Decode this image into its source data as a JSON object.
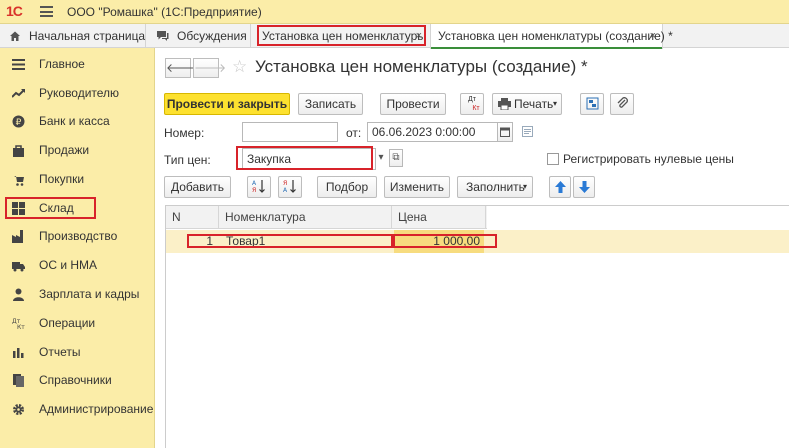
{
  "app": {
    "logo": "1С",
    "title": "ООО \"Ромашка\"  (1С:Предприятие)"
  },
  "tabs": {
    "home": "Начальная страница",
    "discussions": "Обсуждения",
    "prices": "Установка цен номенклатуры",
    "create": "Установка цен номенклатуры (создание) *",
    "close_glyph": "×"
  },
  "sidebar": {
    "items": [
      {
        "label": "Главное",
        "icon": "menu-icon"
      },
      {
        "label": "Руководителю",
        "icon": "trend-icon"
      },
      {
        "label": "Банк и касса",
        "icon": "coin-icon"
      },
      {
        "label": "Продажи",
        "icon": "bag-icon"
      },
      {
        "label": "Покупки",
        "icon": "cart-icon"
      },
      {
        "label": "Склад",
        "icon": "warehouse-icon"
      },
      {
        "label": "Производство",
        "icon": "factory-icon"
      },
      {
        "label": "ОС и НМА",
        "icon": "truck-icon"
      },
      {
        "label": "Зарплата и кадры",
        "icon": "person-icon"
      },
      {
        "label": "Операции",
        "icon": "dt-kt-icon"
      },
      {
        "label": "Отчеты",
        "icon": "bar-chart-icon"
      },
      {
        "label": "Справочники",
        "icon": "books-icon"
      },
      {
        "label": "Администрирование",
        "icon": "gear-icon"
      }
    ]
  },
  "form": {
    "title": "Установка цен номенклатуры (создание) *",
    "toolbar": {
      "post_close": "Провести и закрыть",
      "save": "Записать",
      "post": "Провести",
      "print": "Печать",
      "dtkt_top": "Дт",
      "dtkt_bottom": "Кт"
    },
    "number_label": "Номер:",
    "number_value": "",
    "date_label": "от:",
    "date_value": "06.06.2023  0:00:00",
    "price_type_label": "Тип цен:",
    "price_type_value": "Закупка",
    "register_zero_label": "Регистрировать нулевые цены",
    "table_toolbar": {
      "add": "Добавить",
      "pick": "Подбор",
      "change": "Изменить",
      "fill": "Заполнить"
    },
    "table": {
      "columns": [
        "N",
        "Номенклатура",
        "Цена"
      ],
      "rows": [
        {
          "n": "1",
          "item": "Товар1",
          "price": "1 000,00"
        }
      ]
    }
  },
  "colors": {
    "sidebar_bg": "#fbeda8",
    "primary_button": "#fde12f",
    "highlight_box": "#d8232a",
    "active_tab_underline": "#3a8e3a",
    "selected_row": "#fbf0c8"
  }
}
